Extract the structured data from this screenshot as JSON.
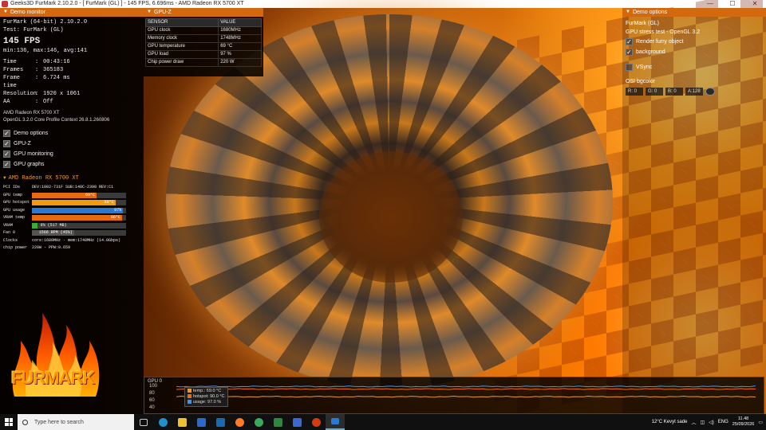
{
  "window": {
    "title": "Geeks3D FurMark 2.10.2.0 - [ FurMark (GL) ] - 145 FPS, 6.696ms - AMD Radeon RX 5700 XT",
    "minimize": "—",
    "maximize": "☐",
    "close": "✕"
  },
  "demo_monitor": {
    "header": "Demo monitor",
    "app_line": "FurMark (64-bit) 2.10.2.0",
    "test_line": "Test: FurMark (GL)",
    "fps": "145 FPS",
    "fps_stats": "min:136, max:146, avg:141",
    "rows": [
      {
        "key": "Time",
        "value": "00:43:16"
      },
      {
        "key": "Frames",
        "value": "365183"
      },
      {
        "key": "Frame time",
        "value": "6.724 ms"
      },
      {
        "key": "Resolution",
        "value": "1920 x 1061"
      },
      {
        "key": "AA",
        "value": "Off"
      }
    ],
    "gpu_name": "AMD Radeon RX 5700 XT",
    "gl_info": "OpenGL 3.2.0 Core Profile Context 26.8.1.260806",
    "options": [
      {
        "label": "Demo options",
        "checked": true
      },
      {
        "label": "GPU-Z",
        "checked": true
      },
      {
        "label": "GPU monitoring",
        "checked": true
      },
      {
        "label": "GPU graphs",
        "checked": true
      }
    ]
  },
  "gpu_monitor": {
    "header": "AMD Radeon RX 5700 XT",
    "pci_label": "PCI IDs",
    "pci_value": "DEV:1002-731F SUB:148C-2398 REV:C1",
    "bars": [
      {
        "label": "GPU temp",
        "text": "69°C",
        "fill": 0.69,
        "color": "#e86a10"
      },
      {
        "label": "GPU hotspot",
        "text": "89°C",
        "fill": 0.89,
        "color": "#f09a10"
      },
      {
        "label": "GPU usage",
        "text": "97%",
        "fill": 0.97,
        "color": "#2a78d0"
      },
      {
        "label": "VRAM temp",
        "text": "96°C",
        "fill": 0.96,
        "color": "#e86a10"
      },
      {
        "label": "VRAM",
        "text": "6% (517 MB)",
        "fill": 0.06,
        "color": "#3aaa3a"
      },
      {
        "label": "Fan 0",
        "text": "1566 RPM (45%)",
        "fill": 0.45,
        "color": "#555555"
      }
    ],
    "clocks_label": "Clocks",
    "clocks_value": "core:1680MHz - mem:1748MHz (14.0Gbps)",
    "power_label": "chip power",
    "power_value": "220W - PPW:0.659"
  },
  "logo_text": "FURMARK",
  "gpuz": {
    "header": "GPU-Z",
    "col_sensor": "SENSOR",
    "col_value": "VALUE",
    "rows": [
      {
        "sensor": "GPU clock",
        "value": "1680MHz"
      },
      {
        "sensor": "Memory clock",
        "value": "1748MHz"
      },
      {
        "sensor": "GPU temperature",
        "value": "69 °C"
      },
      {
        "sensor": "GPU load",
        "value": "97 %"
      },
      {
        "sensor": "Chip power draw",
        "value": "220 W"
      }
    ]
  },
  "demo_options": {
    "header": "Demo options",
    "title": "FurMark (GL)",
    "subtitle": "GPU stress test - OpenGL 3.2",
    "render_furry": "Render furry object",
    "background": "background",
    "vsync": "VSync",
    "bgcolor_label": "OSI bgcolor",
    "r": "R: 0",
    "g": "G: 0",
    "b": "B: 0",
    "a": "A:128"
  },
  "graph": {
    "label": "GPU 0",
    "y_ticks": [
      "100",
      "80",
      "60",
      "40"
    ],
    "legend": [
      {
        "label": "temp.: 69.0 °C",
        "color": "#e89a30"
      },
      {
        "label": "hotspot: 90.0 °C",
        "color": "#f06a10"
      },
      {
        "label": "usage: 97.0 %",
        "color": "#4a90e0"
      }
    ],
    "series": [
      {
        "name": "usage",
        "value": 97,
        "color": "#4a90e0"
      },
      {
        "name": "hotspot",
        "value": 90,
        "color": "#f06a10"
      },
      {
        "name": "temp",
        "value": 69,
        "color": "#e89a30"
      }
    ]
  },
  "taskbar": {
    "search_placeholder": "Type here to search",
    "weather": "12°C  Kevyt sade",
    "lang": "ENG",
    "time": "11.48",
    "date": "25/09/2026"
  }
}
